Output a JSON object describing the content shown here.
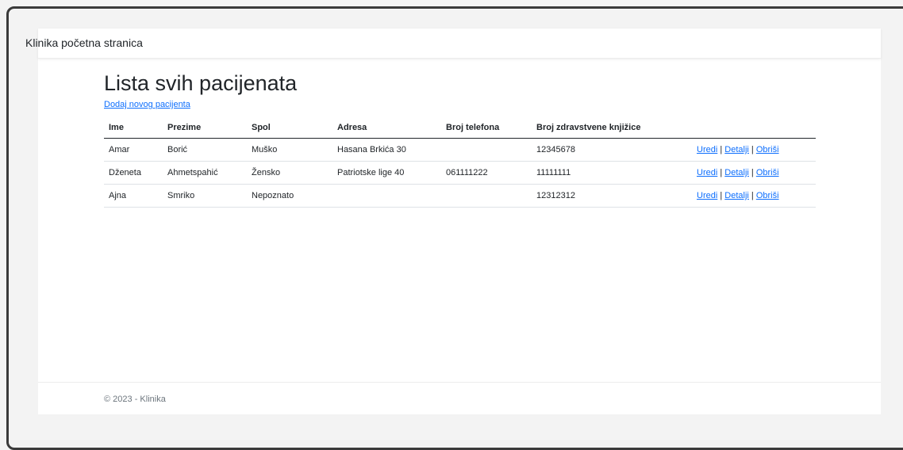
{
  "navbar": {
    "brand": "Klinika početna stranica"
  },
  "main": {
    "title": "Lista svih pacijenata",
    "create_link": "Dodaj novog pacijenta"
  },
  "table": {
    "headers": [
      "Ime",
      "Prezime",
      "Spol",
      "Adresa",
      "Broj telefona",
      "Broj zdravstvene knjižice",
      ""
    ],
    "rows": [
      {
        "ime": "Amar",
        "prezime": "Borić",
        "spol": "Muško",
        "adresa": "Hasana Brkića 30",
        "telefon": "",
        "knjizica": "12345678"
      },
      {
        "ime": "Dženeta",
        "prezime": "Ahmetspahić",
        "spol": "Žensko",
        "adresa": "Patriotske lige 40",
        "telefon": "061111222",
        "knjizica": "11111111"
      },
      {
        "ime": "Ajna",
        "prezime": "Smriko",
        "spol": "Nepoznato",
        "adresa": "",
        "telefon": "",
        "knjizica": "12312312"
      }
    ],
    "actions": {
      "edit": "Uredi",
      "details": "Detalji",
      "delete": "Obriši",
      "separator": "|"
    }
  },
  "footer": {
    "text": "© 2023 - Klinika"
  }
}
